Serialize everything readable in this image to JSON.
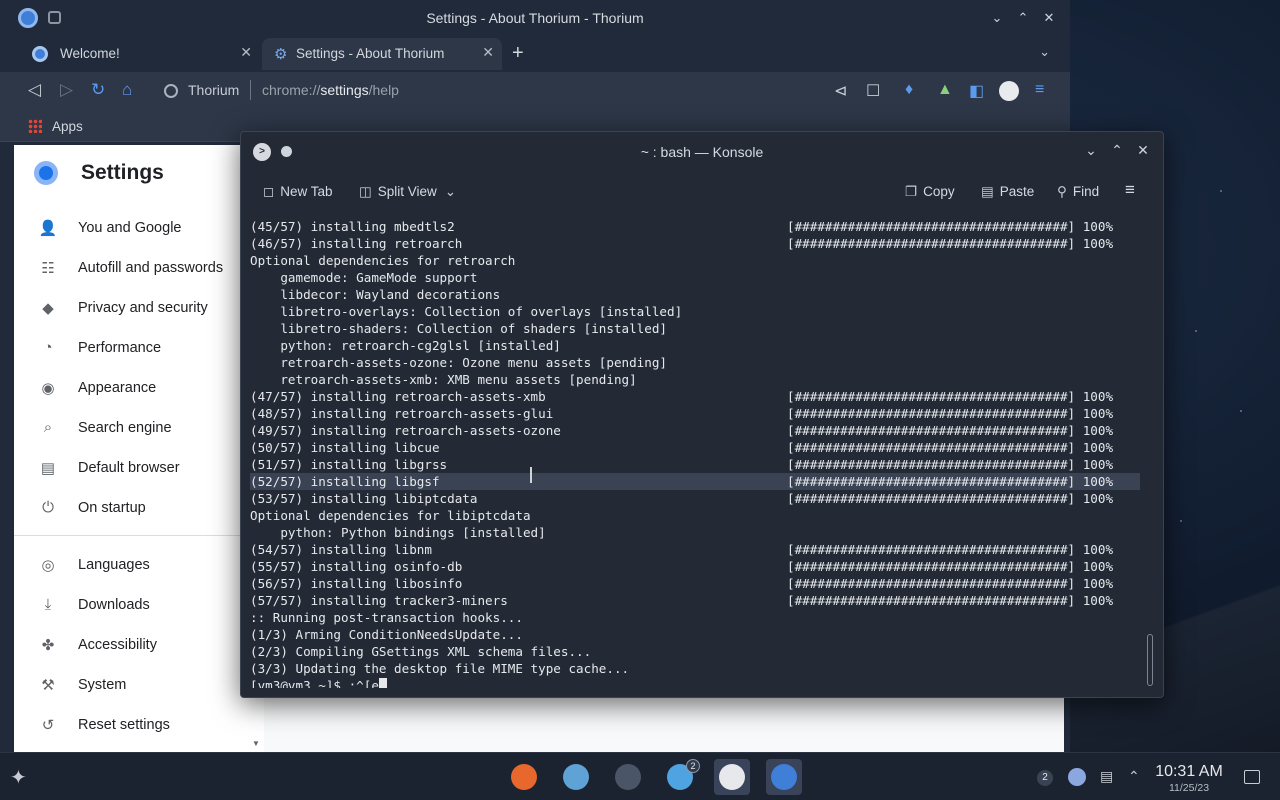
{
  "browser": {
    "window_title": "Settings - About Thorium - Thorium",
    "tabs": [
      {
        "label": "Welcome!",
        "active": false
      },
      {
        "label": "Settings - About Thorium",
        "active": true
      }
    ],
    "address": {
      "site": "Thorium",
      "url_prefix": "chrome://",
      "url_host": "settings",
      "url_path": "/help"
    },
    "bookmarks": {
      "apps_label": "Apps"
    },
    "settings": {
      "title": "Settings",
      "nav": [
        {
          "label": "You and Google",
          "icon": "person-icon"
        },
        {
          "label": "Autofill and passwords",
          "icon": "clipboard-icon"
        },
        {
          "label": "Privacy and security",
          "icon": "shield-icon"
        },
        {
          "label": "Performance",
          "icon": "gauge-icon"
        },
        {
          "label": "Appearance",
          "icon": "palette-icon"
        },
        {
          "label": "Search engine",
          "icon": "search-icon"
        },
        {
          "label": "Default browser",
          "icon": "browser-icon"
        },
        {
          "label": "On startup",
          "icon": "power-icon"
        },
        {
          "label": "Languages",
          "icon": "globe-icon"
        },
        {
          "label": "Downloads",
          "icon": "download-icon"
        },
        {
          "label": "Accessibility",
          "icon": "accessibility-icon"
        },
        {
          "label": "System",
          "icon": "wrench-icon"
        },
        {
          "label": "Reset settings",
          "icon": "reset-icon"
        }
      ]
    }
  },
  "konsole": {
    "title": "~ : bash — Konsole",
    "toolbar": {
      "new_tab": "New Tab",
      "split_view": "Split View",
      "copy": "Copy",
      "paste": "Paste",
      "find": "Find"
    },
    "progress_bar": "[####################################] 100%",
    "lines": [
      {
        "text": "(45/57) installing mbedtls2",
        "bar": true
      },
      {
        "text": "(46/57) installing retroarch",
        "bar": true
      },
      {
        "text": "Optional dependencies for retroarch",
        "bar": false
      },
      {
        "text": "    gamemode: GameMode support",
        "bar": false
      },
      {
        "text": "    libdecor: Wayland decorations",
        "bar": false
      },
      {
        "text": "    libretro-overlays: Collection of overlays [installed]",
        "bar": false
      },
      {
        "text": "    libretro-shaders: Collection of shaders [installed]",
        "bar": false
      },
      {
        "text": "    python: retroarch-cg2glsl [installed]",
        "bar": false
      },
      {
        "text": "    retroarch-assets-ozone: Ozone menu assets [pending]",
        "bar": false
      },
      {
        "text": "    retroarch-assets-xmb: XMB menu assets [pending]",
        "bar": false
      },
      {
        "text": "(47/57) installing retroarch-assets-xmb",
        "bar": true
      },
      {
        "text": "(48/57) installing retroarch-assets-glui",
        "bar": true
      },
      {
        "text": "(49/57) installing retroarch-assets-ozone",
        "bar": true
      },
      {
        "text": "(50/57) installing libcue",
        "bar": true
      },
      {
        "text": "(51/57) installing libgrss",
        "bar": true
      },
      {
        "text": "(52/57) installing libgsf",
        "bar": true,
        "highlight": true
      },
      {
        "text": "(53/57) installing libiptcdata",
        "bar": true
      },
      {
        "text": "Optional dependencies for libiptcdata",
        "bar": false
      },
      {
        "text": "    python: Python bindings [installed]",
        "bar": false
      },
      {
        "text": "(54/57) installing libnm",
        "bar": true
      },
      {
        "text": "(55/57) installing osinfo-db",
        "bar": true
      },
      {
        "text": "(56/57) installing libosinfo",
        "bar": true
      },
      {
        "text": "(57/57) installing tracker3-miners",
        "bar": true
      },
      {
        "text": ":: Running post-transaction hooks...",
        "bar": false
      },
      {
        "text": "(1/3) Arming ConditionNeedsUpdate...",
        "bar": false,
        "mark": true
      },
      {
        "text": "(2/3) Compiling GSettings XML schema files...",
        "bar": false,
        "mark": true
      },
      {
        "text": "(3/3) Updating the desktop file MIME type cache...",
        "bar": false,
        "mark": true
      }
    ],
    "prompt": "[vm3@vm3 ~]$ :^[e"
  },
  "taskbar": {
    "apps": [
      {
        "name": "firefox",
        "color": "#e8672c"
      },
      {
        "name": "files",
        "color": "#5fa2d6"
      },
      {
        "name": "system-settings",
        "color": "#4a5668"
      },
      {
        "name": "discover-shop",
        "color": "#4fa3e0",
        "badge": "2"
      },
      {
        "name": "konsole",
        "color": "#e6e8eb",
        "active": true
      },
      {
        "name": "thorium",
        "color": "#3f7fd8",
        "active": true
      }
    ],
    "tray_badge": "2",
    "time": "10:31 AM",
    "date": "11/25/23"
  },
  "colors": {
    "accent": "#3f7fd8",
    "panel": "#1c2330",
    "terminal_bg": "#232a36"
  }
}
